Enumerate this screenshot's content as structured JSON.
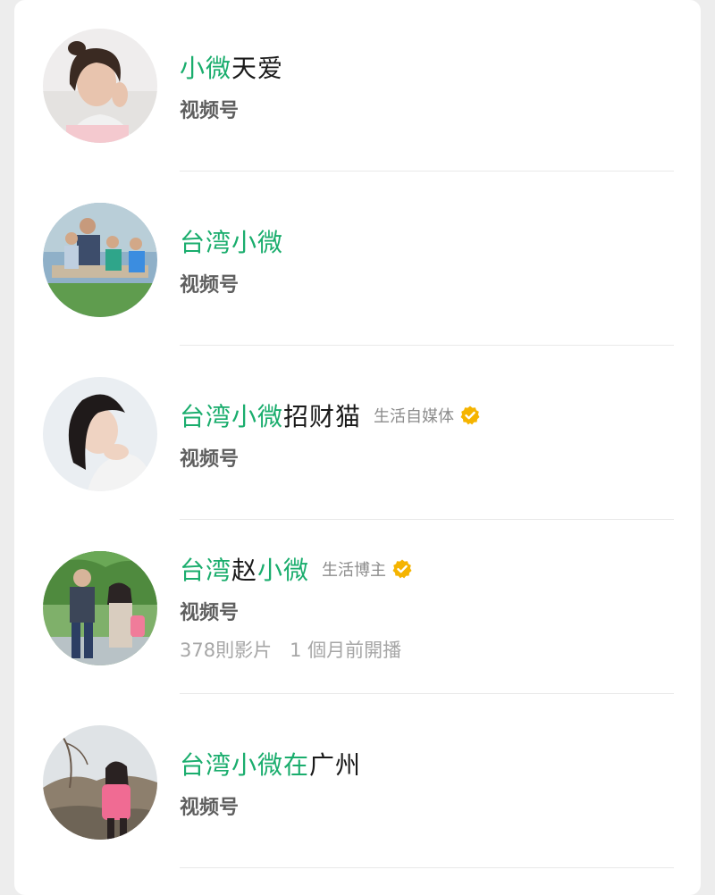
{
  "results": [
    {
      "name_parts": [
        {
          "text": "小微",
          "hl": true
        },
        {
          "text": "天爱",
          "hl": false
        }
      ],
      "tag": "",
      "verified": false,
      "subtitle": "视频号",
      "meta": []
    },
    {
      "name_parts": [
        {
          "text": "台湾小微",
          "hl": true
        }
      ],
      "tag": "",
      "verified": false,
      "subtitle": "视频号",
      "meta": []
    },
    {
      "name_parts": [
        {
          "text": "台湾小微",
          "hl": true
        },
        {
          "text": "招财猫",
          "hl": false
        }
      ],
      "tag": "生活自媒体",
      "verified": true,
      "subtitle": "视频号",
      "meta": []
    },
    {
      "name_parts": [
        {
          "text": "台湾",
          "hl": true
        },
        {
          "text": "赵",
          "hl": false
        },
        {
          "text": "小微",
          "hl": true
        }
      ],
      "tag": "生活博主",
      "verified": true,
      "subtitle": "视频号",
      "meta": [
        "378則影片",
        "1 個月前開播"
      ]
    },
    {
      "name_parts": [
        {
          "text": "台湾小微在",
          "hl": true
        },
        {
          "text": "广州",
          "hl": false
        }
      ],
      "tag": "",
      "verified": false,
      "subtitle": "视频号",
      "meta": []
    }
  ],
  "colors": {
    "highlight": "#1aad6d",
    "verified_badge": "#f5b400",
    "background": "#ededed"
  },
  "icons": {
    "verified": "verified-check-icon"
  }
}
